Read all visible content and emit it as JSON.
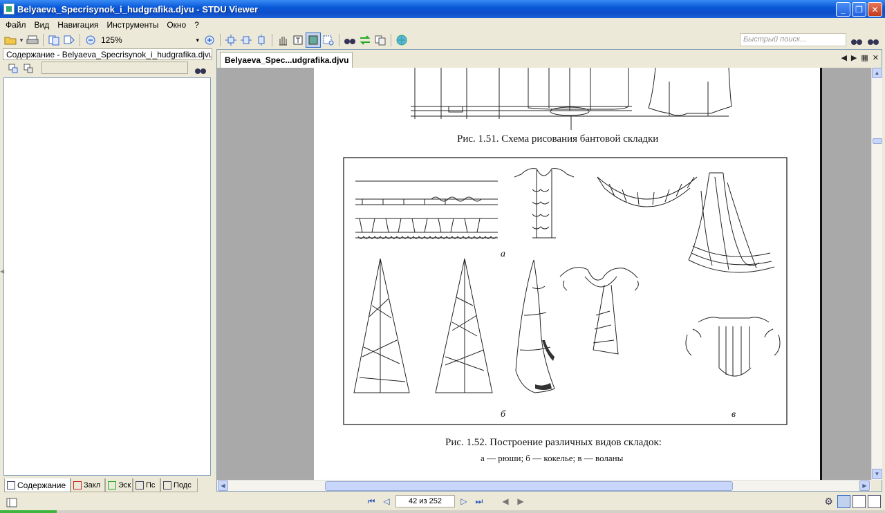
{
  "window": {
    "title": "Belyaeva_Specrisynok_i_hudgrafika.djvu - STDU Viewer",
    "min": "_",
    "max": "❐",
    "close": "✕"
  },
  "menu": [
    "Файл",
    "Вид",
    "Навигация",
    "Инструменты",
    "Окно",
    "?"
  ],
  "toolbar": {
    "zoom_value": "125%",
    "quick_search_placeholder": "Быстрый поиск..."
  },
  "sidebar": {
    "title": "Содержание - Belyaeva_Specrisynok_i_hudgrafika.djvu",
    "tabs": [
      "Содержание",
      "Закл",
      "Эск",
      "Пс",
      "Подс"
    ]
  },
  "document": {
    "tab_label": "Belyaeva_Spec...udgrafika.djvu",
    "fig151_caption": "Рис. 1.51. Схема рисования бантовой складки",
    "fig152_caption": "Рис. 1.52. Построение различных видов складок:",
    "fig152_subcaption": "а — рюши; б — кокелье; в — воланы",
    "label_a": "а",
    "label_b": "б",
    "label_v": "в"
  },
  "status": {
    "page_indicator": "42 из 252"
  }
}
